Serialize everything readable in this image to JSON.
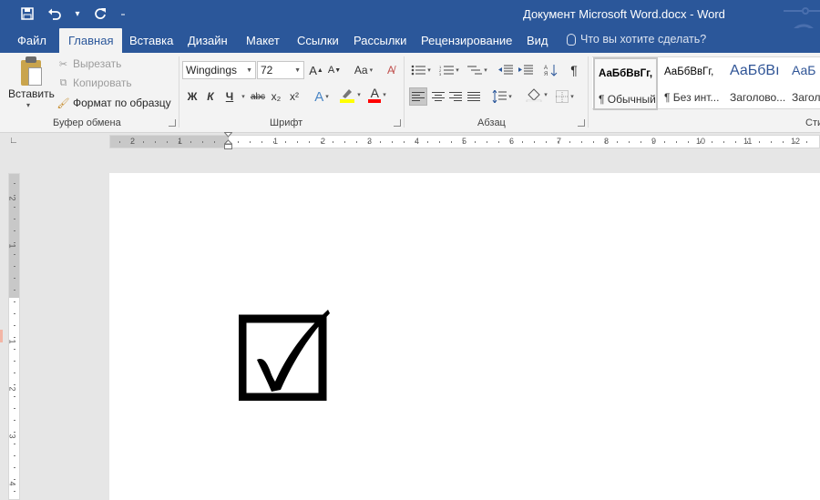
{
  "window": {
    "title": "Документ Microsoft Word.docx - Word"
  },
  "quick_access": {
    "save_icon": "save-icon",
    "undo_icon": "undo-icon",
    "redo_icon": "redo-icon"
  },
  "tabs": [
    {
      "label": "Файл"
    },
    {
      "label": "Главная"
    },
    {
      "label": "Вставка"
    },
    {
      "label": "Дизайн"
    },
    {
      "label": "Макет"
    },
    {
      "label": "Ссылки"
    },
    {
      "label": "Рассылки"
    },
    {
      "label": "Рецензирование"
    },
    {
      "label": "Вид"
    }
  ],
  "tell_me": "Что вы хотите сделать?",
  "clipboard": {
    "paste": "Вставить",
    "cut": "Вырезать",
    "copy": "Копировать",
    "format_painter": "Формат по образцу",
    "group_label": "Буфер обмена"
  },
  "font": {
    "family": "Wingdings",
    "size": "72",
    "grow": "A",
    "shrink": "A",
    "change_case": "Aa",
    "bold": "Ж",
    "italic": "К",
    "underline": "Ч",
    "strikethrough": "abc",
    "subscript": "x₂",
    "superscript": "x²",
    "text_effects": "A",
    "font_color": "A",
    "group_label": "Шрифт"
  },
  "paragraph": {
    "group_label": "Абзац",
    "pilcrow": "¶"
  },
  "styles": {
    "group_label": "Сти",
    "items": [
      {
        "sample": "АаБбВвГг,",
        "name": "¶ Обычный"
      },
      {
        "sample": "АаБбВвГг,",
        "name": "¶ Без инт..."
      },
      {
        "sample": "АаБбВı",
        "name": "Заголово..."
      },
      {
        "sample": "АаБ",
        "name": "Заголо"
      }
    ]
  },
  "ruler": {
    "horizontal": [
      "2",
      "1",
      "1",
      "2",
      "3",
      "4",
      "5",
      "6",
      "7",
      "8",
      "9",
      "10",
      "11",
      "12"
    ],
    "vertical": [
      "2",
      "1",
      "1",
      "2",
      "3",
      "4"
    ]
  },
  "colors": {
    "accent": "#2b579a",
    "highlight": "#ffff00",
    "font_color": "#ff0000"
  },
  "document": {
    "symbol": "checkbox-checked"
  }
}
